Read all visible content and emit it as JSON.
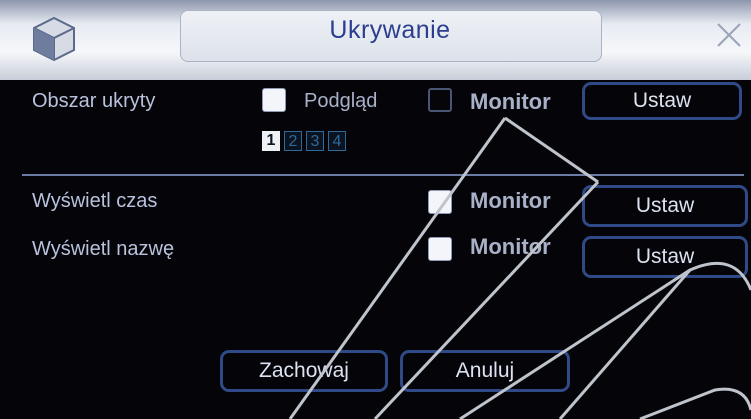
{
  "dialog": {
    "title": "Ukrywanie",
    "close_icon": "close-icon",
    "logo_icon": "cube-logo-icon"
  },
  "privacy": {
    "label": "Obszar ukryty",
    "preview_label": "Podgląd",
    "preview_checked": true,
    "monitor_label": "Monitor",
    "monitor_checked": false,
    "set_label": "Ustaw",
    "areas": [
      "1",
      "2",
      "3",
      "4"
    ],
    "selected_area": "1"
  },
  "time_overlay": {
    "label": "Wyświetl czas",
    "monitor_label": "Monitor",
    "monitor_checked": true,
    "set_label": "Ustaw"
  },
  "name_overlay": {
    "label": "Wyświetl nazwę",
    "monitor_label": "Monitor",
    "monitor_checked": true,
    "set_label": "Ustaw"
  },
  "footer": {
    "save_label": "Zachowaj",
    "cancel_label": "Anuluj"
  },
  "colors": {
    "title": "#2b3d8f",
    "button_border": "#2f4a86",
    "text": "#b9c2dd"
  }
}
